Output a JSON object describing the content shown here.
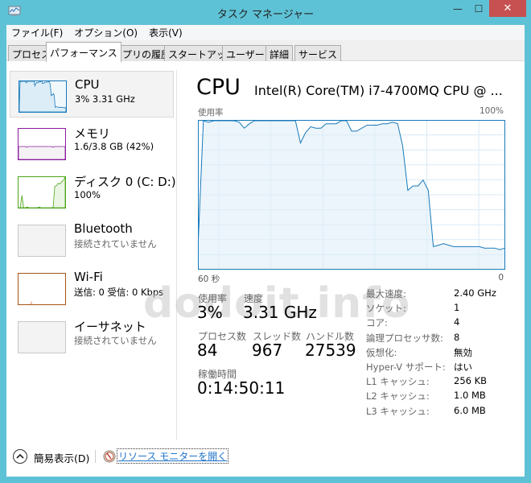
{
  "window": {
    "title": "タスク マネージャー",
    "controls": {
      "minimize": "—",
      "maximize": "☐",
      "close": "✕"
    }
  },
  "menubar": [
    "ファイル(F)",
    "オプション(O)",
    "表示(V)"
  ],
  "tabs": [
    {
      "label": "プロセス",
      "active": false
    },
    {
      "label": "パフォーマンス",
      "active": true
    },
    {
      "label": "アプリの履歴",
      "active": false
    },
    {
      "label": "スタートアップ",
      "active": false
    },
    {
      "label": "ユーザー",
      "active": false
    },
    {
      "label": "詳細",
      "active": false
    },
    {
      "label": "サービス",
      "active": false
    }
  ],
  "sidebar": {
    "items": [
      {
        "name": "CPU",
        "sub": "3% 3.31 GHz",
        "color": "#1779ba",
        "selected": true
      },
      {
        "name": "メモリ",
        "sub": "1.6/3.8 GB (42%)",
        "color": "#8b1c9e",
        "selected": false
      },
      {
        "name": "ディスク 0 (C: D:)",
        "sub": "100%",
        "color": "#4da51b",
        "selected": false
      },
      {
        "name": "Bluetooth",
        "sub": "接続されていません",
        "color": "#b0b0b0",
        "selected": false
      },
      {
        "name": "Wi-Fi",
        "sub": "送信: 0 受信: 0 Kbps",
        "color": "#a7541a",
        "selected": false
      },
      {
        "name": "イーサネット",
        "sub": "接続されていません",
        "color": "#b0b0b0",
        "selected": false
      }
    ]
  },
  "main": {
    "title": "CPU",
    "model": "Intel(R) Core(TM) i7-4700MQ CPU @ ...",
    "chart_top_left": "使用率",
    "chart_top_right": "100%",
    "chart_bottom_left": "60 秒",
    "chart_bottom_right": "0",
    "stats": {
      "usage_label": "使用率",
      "usage_value": "3%",
      "speed_label": "速度",
      "speed_value": "3.31 GHz",
      "processes_label": "プロセス数",
      "processes_value": "84",
      "threads_label": "スレッド数",
      "threads_value": "967",
      "handles_label": "ハンドル数",
      "handles_value": "27539",
      "uptime_label": "稼働時間",
      "uptime_value": "0:14:50:11"
    },
    "specs": [
      {
        "label": "最大速度:",
        "value": "2.40 GHz"
      },
      {
        "label": "ソケット:",
        "value": "1"
      },
      {
        "label": "コア:",
        "value": "4"
      },
      {
        "label": "論理プロセッサ数:",
        "value": "8"
      },
      {
        "label": "仮想化:",
        "value": "無効"
      },
      {
        "label": "Hyper-V サポート:",
        "value": "はい"
      },
      {
        "label": "L1 キャッシュ:",
        "value": "256 KB"
      },
      {
        "label": "L2 キャッシュ:",
        "value": "1.0 MB"
      },
      {
        "label": "L3 キャッシュ:",
        "value": "6.0 MB"
      }
    ]
  },
  "footer": {
    "fewer_details": "簡易表示(D)",
    "resource_monitor": "リソース モニターを開く"
  },
  "watermark": "dodoit.info",
  "chart_data": {
    "type": "area",
    "title": "CPU 使用率",
    "xlabel": "60 秒",
    "ylabel": "使用率",
    "xlim": [
      60,
      0
    ],
    "ylim": [
      0,
      100
    ],
    "grid": true,
    "color": "#1779ba",
    "x_seconds_ago": [
      60,
      59,
      58,
      57,
      56,
      55,
      54,
      53,
      52,
      51,
      50,
      49,
      48,
      47,
      46,
      45,
      44,
      43,
      42,
      41,
      40,
      39,
      38,
      37,
      36,
      35,
      34,
      33,
      32,
      31,
      30,
      29,
      28,
      27,
      26,
      25,
      24,
      23,
      22,
      21,
      20,
      19,
      18,
      17,
      16,
      15,
      14,
      13,
      12,
      11,
      10,
      9,
      8,
      7,
      6,
      5,
      4,
      3,
      2,
      1,
      0
    ],
    "values": [
      20,
      100,
      99,
      100,
      100,
      100,
      100,
      100,
      99,
      95,
      98,
      100,
      100,
      100,
      100,
      100,
      100,
      100,
      100,
      100,
      85,
      92,
      96,
      95,
      95,
      98,
      98,
      98,
      100,
      100,
      93,
      93,
      95,
      97,
      97,
      97,
      98,
      98,
      99,
      98,
      83,
      53,
      56,
      56,
      60,
      53,
      15,
      16,
      17,
      16,
      15,
      15,
      15,
      15,
      15,
      15,
      14,
      14,
      14,
      13,
      14
    ],
    "sidebar_series": {
      "memory_percent": [
        42,
        42,
        42,
        42,
        40,
        42,
        42,
        42,
        42,
        42,
        42,
        42,
        42,
        42,
        42,
        42,
        42,
        40,
        42,
        42,
        42,
        42,
        42,
        42
      ],
      "disk_percent": [
        0,
        0,
        40,
        0,
        0,
        2,
        0,
        0,
        0,
        0,
        0,
        0,
        2,
        0,
        0,
        0,
        0,
        0,
        0,
        0,
        1,
        70,
        72,
        80,
        78,
        85,
        90,
        100
      ]
    }
  }
}
